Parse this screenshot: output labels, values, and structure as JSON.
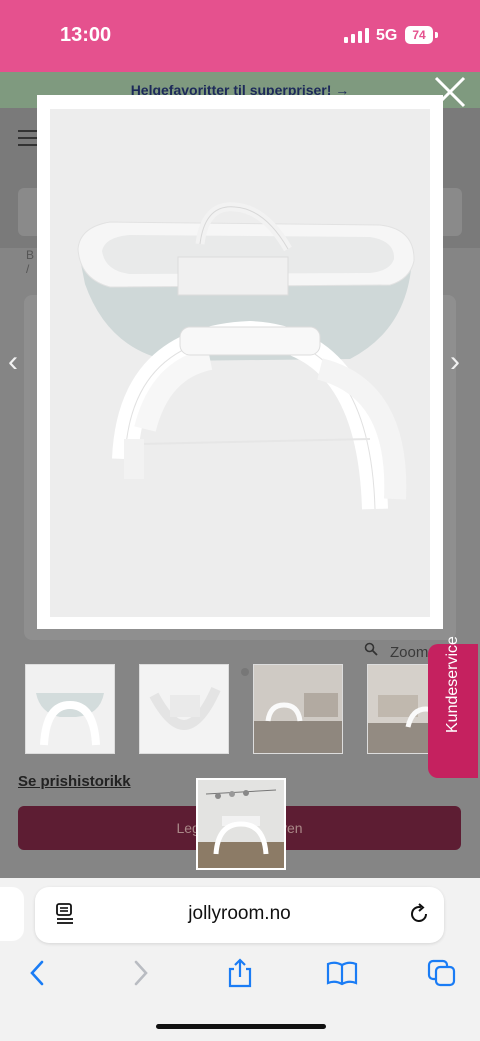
{
  "status_bar": {
    "time": "13:00",
    "network": "5G",
    "battery": "74"
  },
  "page": {
    "promo_text": "Helgefavoritter til superpriser! →",
    "breadcrumb_1": "B",
    "breadcrumb_2": "/",
    "zoom_label": "Zoom",
    "price_history": "Se prishistorikk",
    "basket_button": "Legg i handlekurven"
  },
  "thumbnails": [
    {
      "name": "bassinet-front"
    },
    {
      "name": "bassinet-rocking"
    },
    {
      "name": "bassinet-living-room"
    },
    {
      "name": "bassinet-living-room-2"
    },
    {
      "name": "bassinet-nursery",
      "active": true
    }
  ],
  "kundeservice": {
    "label": "Kundeservice"
  },
  "browser": {
    "url": "jollyroom.no"
  },
  "colors": {
    "status_bar": "#e5518e",
    "kundeservice": "#c5215f",
    "basket": "#5d1d33"
  },
  "icons": [
    "menu-icon",
    "close-icon",
    "search-icon",
    "reader-icon",
    "reload-icon",
    "back-icon",
    "forward-icon",
    "share-icon",
    "bookmarks-icon",
    "tabs-icon"
  ]
}
